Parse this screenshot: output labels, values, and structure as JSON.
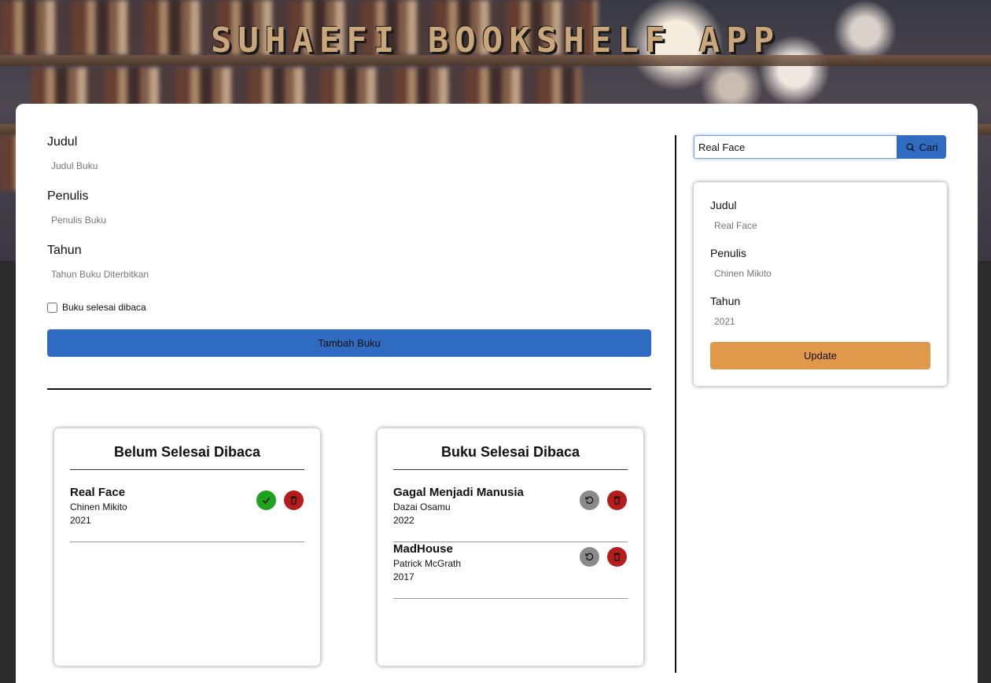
{
  "app": {
    "title": "SUHAEFI BOOKSHELF APP"
  },
  "form": {
    "title_label": "Judul",
    "title_placeholder": "Judul Buku",
    "author_label": "Penulis",
    "author_placeholder": "Penulis Buku",
    "year_label": "Tahun",
    "year_placeholder": "Tahun Buku Diterbitkan",
    "complete_label": "Buku selesai dibaca",
    "submit_label": "Tambah Buku"
  },
  "search": {
    "value": "Real Face",
    "button_label": "Cari",
    "icon": "search-icon"
  },
  "edit": {
    "title_label": "Judul",
    "title_value": "Real Face",
    "author_label": "Penulis",
    "author_value": "Chinen Mikito",
    "year_label": "Tahun",
    "year_value": "2021",
    "button_label": "Update"
  },
  "shelves": {
    "incomplete": {
      "title": "Belum Selesai Dibaca",
      "books": [
        {
          "title": "Real Face",
          "author": "Chinen Mikito",
          "year": "2021"
        }
      ]
    },
    "complete": {
      "title": "Buku Selesai Dibaca",
      "books": [
        {
          "title": "Gagal Menjadi Manusia",
          "author": "Dazai Osamu",
          "year": "2022"
        },
        {
          "title": "MadHouse",
          "author": "Patrick McGrath",
          "year": "2017"
        }
      ]
    }
  },
  "colors": {
    "primary": "#2f6bc0",
    "update": "#e0984a",
    "done": "#1fa31f",
    "delete": "#b51c1c",
    "undo": "#8a8a8a"
  }
}
